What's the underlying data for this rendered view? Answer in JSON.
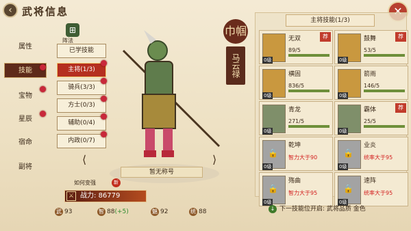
{
  "header": {
    "title": "武将信息",
    "back_icon": "back-arrow-icon",
    "close_icon": "close-icon"
  },
  "sidebar": {
    "items": [
      {
        "label": "属性",
        "active": false,
        "dot": false
      },
      {
        "label": "技能",
        "active": true,
        "dot": true
      },
      {
        "label": "宝物",
        "active": false,
        "dot": true
      },
      {
        "label": "星辰",
        "active": false,
        "dot": true
      },
      {
        "label": "宿命",
        "active": false,
        "dot": false
      },
      {
        "label": "副将",
        "active": false,
        "dot": false
      }
    ]
  },
  "formation": {
    "label": "阵法"
  },
  "skill_types": [
    {
      "label": "已学技能",
      "active": false,
      "dot": false
    },
    {
      "label": "主将(1/3)",
      "active": true,
      "dot": true
    },
    {
      "label": "骑兵(3/3)",
      "active": false,
      "dot": true
    },
    {
      "label": "方士(0/3)",
      "active": false,
      "dot": true
    },
    {
      "label": "辅助(0/4)",
      "active": false,
      "dot": true
    },
    {
      "label": "内政(0/7)",
      "active": false,
      "dot": true
    }
  ],
  "hero": {
    "name": "马云禄",
    "badge": "巾帼",
    "title": "暂无称号",
    "howto": "如何变强",
    "new_tag": "新"
  },
  "power": {
    "label": "战力:",
    "value": "86779"
  },
  "stats": [
    {
      "icon": "武",
      "value": "93",
      "bonus": ""
    },
    {
      "icon": "智",
      "value": "88",
      "bonus": "(+5)"
    },
    {
      "icon": "魅",
      "value": "92",
      "bonus": ""
    },
    {
      "icon": "统",
      "value": "88",
      "bonus": ""
    }
  ],
  "panel": {
    "title": "主将技能(1/3)"
  },
  "skill_cards": [
    {
      "name": "无双",
      "count": "89/5",
      "fill": 1.0,
      "level": "0级",
      "tag": "荐",
      "style": "gold",
      "req": ""
    },
    {
      "name": "鼓舞",
      "count": "53/5",
      "fill": 1.0,
      "level": "0级",
      "tag": "荐",
      "style": "gold",
      "req": ""
    },
    {
      "name": "横固",
      "count": "836/5",
      "fill": 1.0,
      "level": "0级",
      "tag": "",
      "style": "gold",
      "req": ""
    },
    {
      "name": "箭雨",
      "count": "146/5",
      "fill": 1.0,
      "level": "0级",
      "tag": "",
      "style": "gold",
      "req": ""
    },
    {
      "name": "青龙",
      "count": "271/5",
      "fill": 1.0,
      "level": "0级",
      "tag": "",
      "style": "green",
      "req": ""
    },
    {
      "name": "霸体",
      "count": "25/5",
      "fill": 1.0,
      "level": "0级",
      "tag": "荐",
      "style": "green",
      "req": ""
    },
    {
      "name": "乾坤",
      "count": "",
      "fill": 0,
      "level": "0级",
      "tag": "",
      "style": "locked",
      "req": "智力大于90"
    },
    {
      "name": "业炎",
      "count": "",
      "fill": 0,
      "level": "0级",
      "tag": "",
      "style": "locked",
      "req": "统率大于95"
    },
    {
      "name": "殇曲",
      "count": "",
      "fill": 0,
      "level": "0级",
      "tag": "",
      "style": "locked",
      "req": "智力大于95"
    },
    {
      "name": "速阵",
      "count": "",
      "fill": 0,
      "level": "0级",
      "tag": "",
      "style": "locked",
      "req": "统率大于95"
    }
  ],
  "footer": {
    "text": "下一技能位开启: 武将品质 金色"
  }
}
